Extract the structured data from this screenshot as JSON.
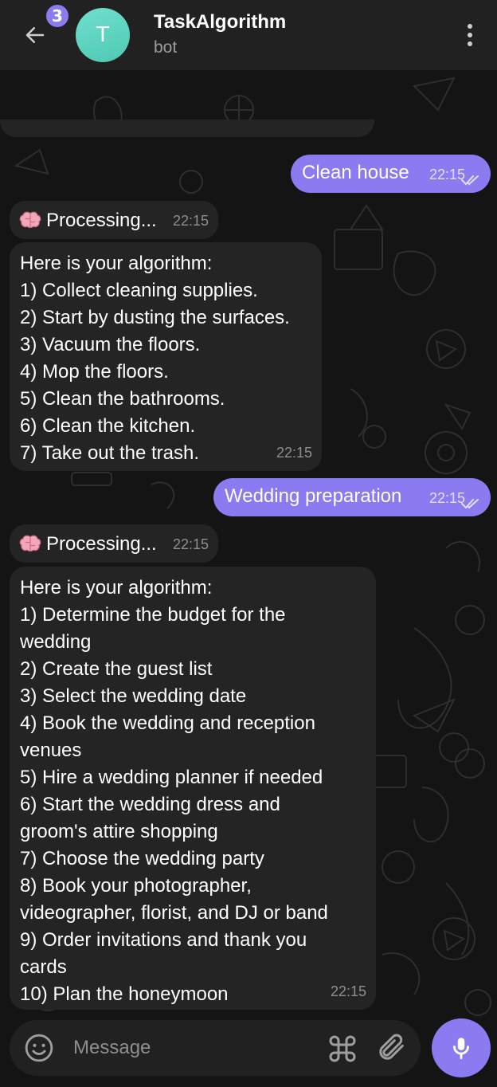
{
  "header": {
    "unread_count": "3",
    "avatar_letter": "T",
    "title": "TaskAlgorithm",
    "subtitle": "bot"
  },
  "messages": [
    {
      "direction": "out",
      "text": "Clean house",
      "time": "22:15",
      "status": "read"
    },
    {
      "direction": "in",
      "icon": "brain-icon",
      "text": "Processing...",
      "time": "22:15"
    },
    {
      "direction": "in",
      "time": "22:15",
      "lines": [
        "Here is your algorithm:",
        "1) Collect cleaning supplies.",
        "2) Start by dusting the surfaces.",
        "3) Vacuum the floors.",
        "4) Mop the floors.",
        "5) Clean the bathrooms.",
        "6) Clean the kitchen.",
        "7) Take out the trash."
      ]
    },
    {
      "direction": "out",
      "text": "Wedding preparation",
      "time": "22:15",
      "status": "read"
    },
    {
      "direction": "in",
      "icon": "brain-icon",
      "text": "Processing...",
      "time": "22:15"
    },
    {
      "direction": "in",
      "time": "22:15",
      "lines": [
        "Here is your algorithm:",
        "1) Determine the budget for the",
        "wedding",
        "2) Create the guest list",
        "3) Select the wedding date",
        "4) Book the wedding and reception",
        "venues",
        "5) Hire a wedding planner if needed",
        "6) Start the wedding dress and",
        "groom's attire shopping",
        "7) Choose the wedding party",
        "8) Book your photographer,",
        "videographer, florist, and DJ or band",
        "9) Order invitations and thank you",
        "cards",
        "10) Plan the honeymoon"
      ]
    }
  ],
  "input": {
    "placeholder": "Message"
  },
  "colors": {
    "accent": "#8a7cf0",
    "header_bg": "#212121",
    "incoming_bubble": "#242424",
    "chat_bg": "#141414"
  }
}
